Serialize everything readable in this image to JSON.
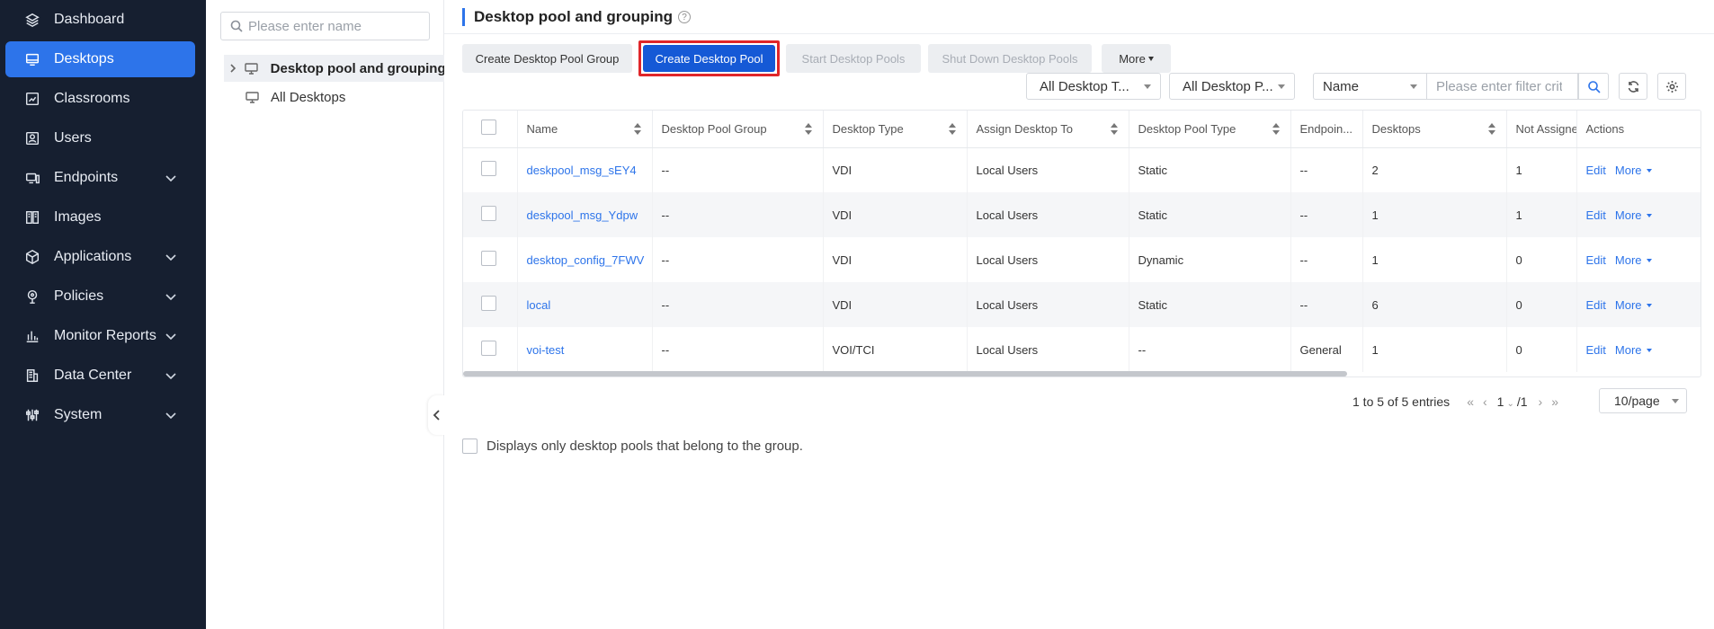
{
  "sidebar": {
    "items": [
      {
        "label": "Dashboard",
        "icon": "layers-icon",
        "active": false,
        "expandable": false
      },
      {
        "label": "Desktops",
        "icon": "desktop-icon",
        "active": true,
        "expandable": false
      },
      {
        "label": "Classrooms",
        "icon": "classroom-icon",
        "active": false,
        "expandable": false
      },
      {
        "label": "Users",
        "icon": "user-icon",
        "active": false,
        "expandable": false
      },
      {
        "label": "Endpoints",
        "icon": "endpoint-icon",
        "active": false,
        "expandable": true
      },
      {
        "label": "Images",
        "icon": "image-icon",
        "active": false,
        "expandable": false
      },
      {
        "label": "Applications",
        "icon": "cube-icon",
        "active": false,
        "expandable": true
      },
      {
        "label": "Policies",
        "icon": "policy-icon",
        "active": false,
        "expandable": true
      },
      {
        "label": "Monitor Reports",
        "icon": "bar-chart-icon",
        "active": false,
        "expandable": true
      },
      {
        "label": "Data Center",
        "icon": "building-icon",
        "active": false,
        "expandable": true
      },
      {
        "label": "System",
        "icon": "settings-sliders-icon",
        "active": false,
        "expandable": true
      }
    ]
  },
  "tree": {
    "search_placeholder": "Please enter name",
    "nodes": [
      {
        "label": "Desktop pool and grouping",
        "selected": true
      },
      {
        "label": "All Desktops",
        "selected": false
      }
    ]
  },
  "main": {
    "title": "Desktop pool and grouping",
    "help_glyph": "?",
    "toolbar": {
      "create_group": "Create Desktop Pool Group",
      "create_pool": "Create Desktop Pool",
      "start_pools": "Start Desktop Pools",
      "shutdown_pools": "Shut Down Desktop Pools",
      "more": "More"
    },
    "filters": {
      "desktop_type": "All Desktop T...",
      "desktop_pool_type": "All Desktop P...",
      "field": "Name",
      "filter_placeholder": "Please enter filter crit..."
    },
    "table": {
      "columns": [
        "Name",
        "Desktop Pool Group",
        "Desktop Type",
        "Assign Desktop To",
        "Desktop Pool Type",
        "Endpoin...",
        "Desktops",
        "Not Assigned",
        "Actions"
      ],
      "rows": [
        {
          "name": "deskpool_msg_sEY4",
          "group": "--",
          "type": "VDI",
          "assign": "Local Users",
          "pool_type": "Static",
          "endpoint": "--",
          "desktops": "2",
          "not_assigned": "1"
        },
        {
          "name": "deskpool_msg_Ydpw",
          "group": "--",
          "type": "VDI",
          "assign": "Local Users",
          "pool_type": "Static",
          "endpoint": "--",
          "desktops": "1",
          "not_assigned": "1"
        },
        {
          "name": "desktop_config_7FWV",
          "group": "--",
          "type": "VDI",
          "assign": "Local Users",
          "pool_type": "Dynamic",
          "endpoint": "--",
          "desktops": "1",
          "not_assigned": "0"
        },
        {
          "name": "local",
          "group": "--",
          "type": "VDI",
          "assign": "Local Users",
          "pool_type": "Static",
          "endpoint": "--",
          "desktops": "6",
          "not_assigned": "0"
        },
        {
          "name": "voi-test",
          "group": "--",
          "type": "VOI/TCI",
          "assign": "Local Users",
          "pool_type": "--",
          "endpoint": "General",
          "desktops": "1",
          "not_assigned": "0"
        }
      ],
      "action_edit": "Edit",
      "action_more": "More"
    },
    "pagination": {
      "summary": "1 to 5 of 5 entries",
      "current_page": "1",
      "total_pages": "/1",
      "page_size": "10/page"
    },
    "footer_checkbox_label": "Displays only desktop pools that belong to the group."
  },
  "colors": {
    "sidebar_bg": "#161f30",
    "accent": "#2d74ea",
    "primary_button": "#1559d6",
    "highlight": "#e0262a"
  }
}
